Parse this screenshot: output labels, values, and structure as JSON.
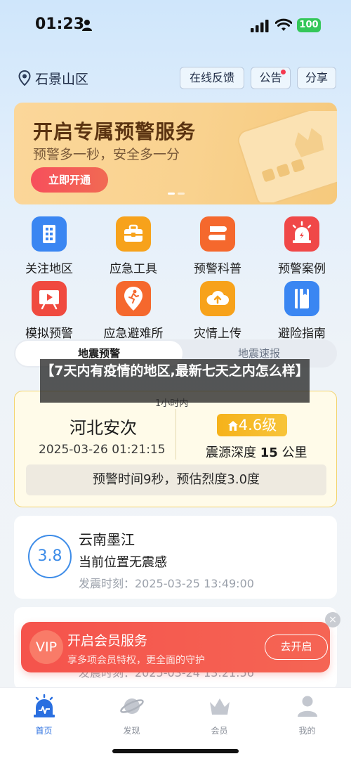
{
  "status_bar": {
    "time": "01:23",
    "battery": "100"
  },
  "header": {
    "location": "石景山区",
    "buttons": {
      "feedback": "在线反馈",
      "notice": "公告",
      "share": "分享"
    }
  },
  "banner": {
    "title": "开启专属预警服务",
    "subtitle": "预警多一秒，安全多一分",
    "button": "立即开通"
  },
  "grid": [
    {
      "label": "关注地区",
      "icon": "building-icon",
      "color": "#3a86f2"
    },
    {
      "label": "应急工具",
      "icon": "toolbox-icon",
      "color": "#f7a21b"
    },
    {
      "label": "预警科普",
      "icon": "book-stack-icon",
      "color": "#f5682d"
    },
    {
      "label": "预警案例",
      "icon": "alarm-light-icon",
      "color": "#f04848"
    },
    {
      "label": "模拟预警",
      "icon": "presentation-icon",
      "color": "#f04a3f"
    },
    {
      "label": "应急避难所",
      "icon": "running-person-pin-icon",
      "color": "#f5682d"
    },
    {
      "label": "灾情上传",
      "icon": "cloud-upload-icon",
      "color": "#f7a21b"
    },
    {
      "label": "避险指南",
      "icon": "guide-book-icon",
      "color": "#3a86f2"
    }
  ],
  "tabs": {
    "active": "地震预警",
    "inactive": "地震速报"
  },
  "overlay_title": "【7天内有疫情的地区,最新七天之内怎么样】",
  "alert": {
    "time_tag": "1小时内",
    "place": "河北安次",
    "datetime": "2025-03-26 01:21:15",
    "magnitude": "4.6级",
    "depth_prefix": "震源深度",
    "depth_value": "15",
    "depth_unit": "公里",
    "bar_text": "预警时间9秒，预估烈度3.0度"
  },
  "quakes": [
    {
      "magnitude": "3.8",
      "place": "云南墨江",
      "status": "当前位置无震感",
      "time": "发震时刻：2025-03-25 13:49:00"
    },
    {
      "time": "发震时刻：2025-03-24 13:21:56"
    }
  ],
  "vip": {
    "badge": "VIP",
    "title": "开启会员服务",
    "subtitle": "享多项会员特权，更全面的守护",
    "button": "去开启",
    "close": "×"
  },
  "tabbar": [
    {
      "label": "首页",
      "icon": "home-alert-icon",
      "active": true
    },
    {
      "label": "发现",
      "icon": "planet-icon",
      "active": false
    },
    {
      "label": "会员",
      "icon": "crown-icon",
      "active": false
    },
    {
      "label": "我的",
      "icon": "user-icon",
      "active": false
    }
  ],
  "colors": {
    "primary": "#2a6fe0",
    "alert_yellow": "#f6b21a",
    "vip_red": "#f5534c"
  }
}
